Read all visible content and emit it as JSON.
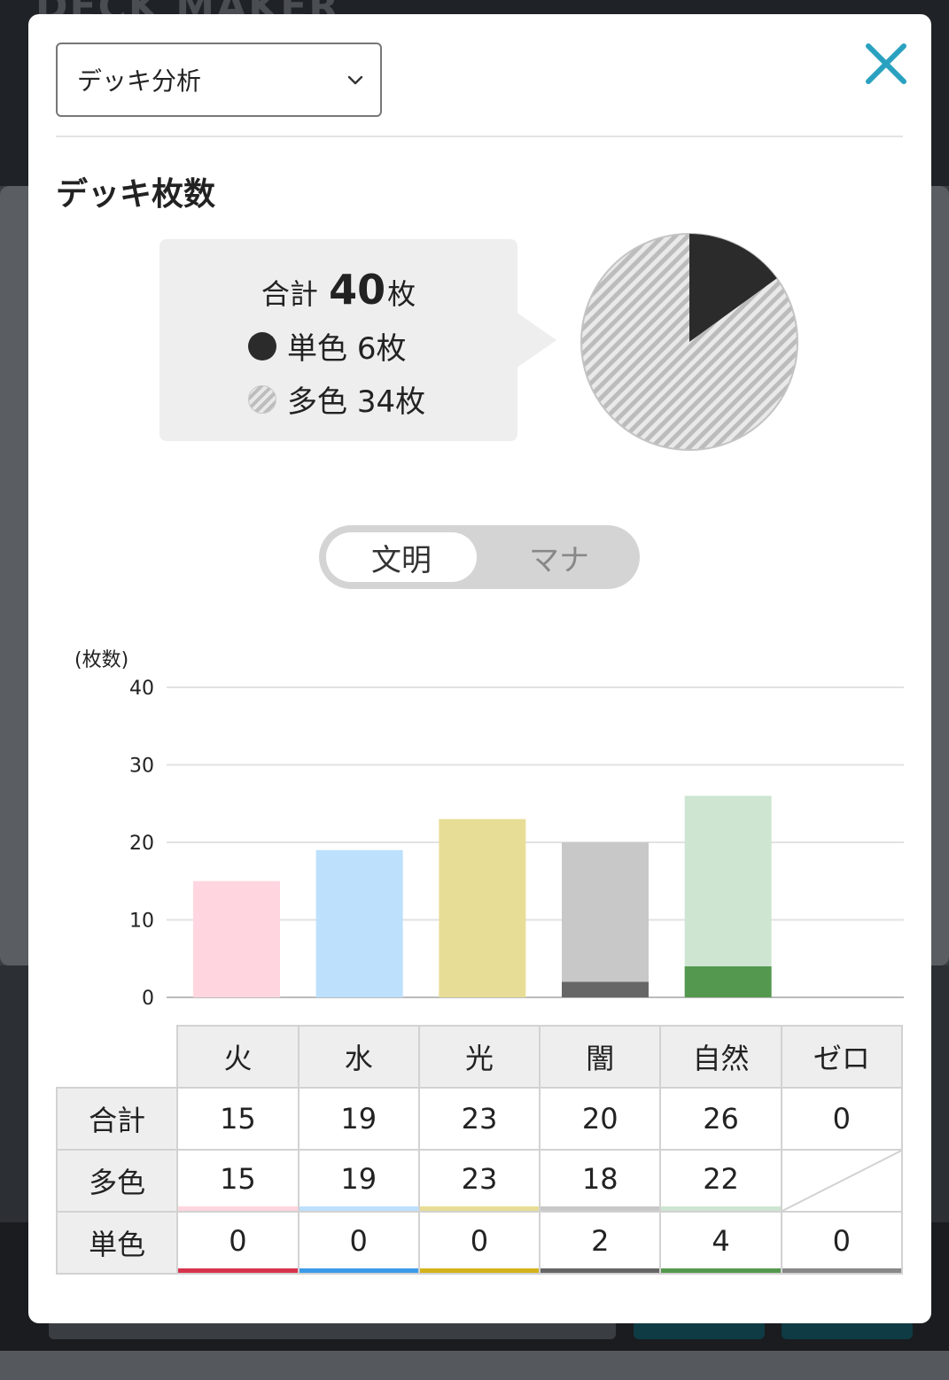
{
  "background": {
    "brand": "DECK MAKER"
  },
  "dialog": {
    "select": {
      "value": "デッキ分析"
    },
    "section_title": "デッキ枚数",
    "summary": {
      "total_prefix": "合計",
      "total_value": "40",
      "total_unit": "枚",
      "mono": {
        "label": "単色",
        "count": "6枚",
        "value": 6
      },
      "multi": {
        "label": "多色",
        "count": "34枚",
        "value": 34
      }
    },
    "toggle": {
      "active": "文明",
      "inactive": "マナ"
    }
  },
  "colors": {
    "pie_mono": "#2b2b2b",
    "multi_bars": [
      "#ffd6df",
      "#bde0fd",
      "#e8dd96",
      "#c8c8c8",
      "#cde5d1"
    ],
    "mono_bars": [
      "#d6334d",
      "#3c9be8",
      "#d3b31a",
      "#666666",
      "#54984f"
    ],
    "zero_line": "#888888",
    "close": "#2aa1c0"
  },
  "chart_data": {
    "type": "bar",
    "stacked": true,
    "ylabel": "(枚数)",
    "ylim": [
      0,
      40
    ],
    "yticks": [
      "0",
      "10",
      "20",
      "30",
      "40"
    ],
    "grid": true,
    "categories": [
      "火",
      "水",
      "光",
      "闇",
      "自然",
      "ゼロ"
    ],
    "series": [
      {
        "name": "単色",
        "values": [
          0,
          0,
          0,
          2,
          4,
          0
        ]
      },
      {
        "name": "多色",
        "values": [
          15,
          19,
          23,
          18,
          22,
          0
        ]
      }
    ]
  },
  "table": {
    "headers": [
      "火",
      "水",
      "光",
      "闇",
      "自然",
      "ゼロ"
    ],
    "rows": [
      {
        "label": "合計",
        "cells": [
          "15",
          "19",
          "23",
          "20",
          "26",
          "0"
        ]
      },
      {
        "label": "多色",
        "cells": [
          "15",
          "19",
          "23",
          "18",
          "22",
          ""
        ]
      },
      {
        "label": "単色",
        "cells": [
          "0",
          "0",
          "0",
          "2",
          "4",
          "0"
        ]
      }
    ]
  }
}
